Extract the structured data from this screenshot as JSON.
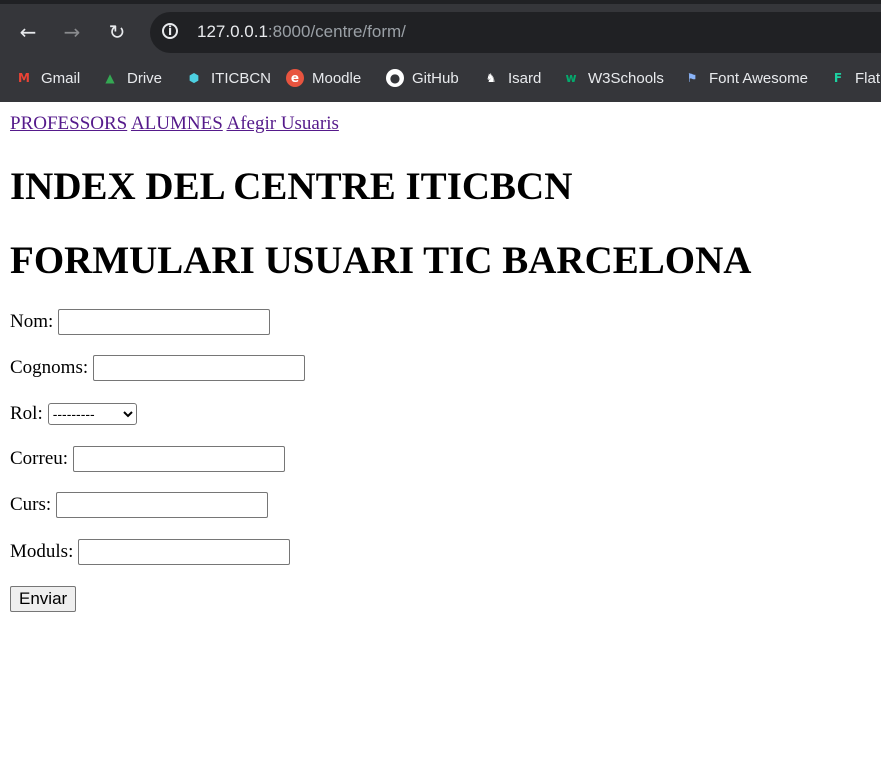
{
  "browser": {
    "back_icon": "arrow-left-icon",
    "forward_icon": "arrow-right-icon",
    "reload_icon": "reload-icon",
    "url_host": "127.0.0.1",
    "url_rest": ":8000/centre/form/",
    "bookmarks": [
      {
        "label": "Gmail",
        "icon": "gmail-icon",
        "color": "#ea4335"
      },
      {
        "label": "Drive",
        "icon": "drive-icon",
        "color": "#34a853"
      },
      {
        "label": "ITICBCN",
        "icon": "iticbcn-icon",
        "color": "#4dd0e1"
      },
      {
        "label": "Moodle",
        "icon": "moodle-icon",
        "color": "#e8543f"
      },
      {
        "label": "GitHub",
        "icon": "github-icon",
        "color": "#ffffff"
      },
      {
        "label": "Isard",
        "icon": "isard-icon",
        "color": "#ffffff"
      },
      {
        "label": "W3Schools",
        "icon": "w3schools-icon",
        "color": "#04aa6d"
      },
      {
        "label": "Font Awesome",
        "icon": "flag-icon",
        "color": "#8ab4f8"
      },
      {
        "label": "Flat",
        "icon": "flaticon-icon",
        "color": "#1dd1a1"
      }
    ]
  },
  "nav": {
    "professors": "PROFESSORS",
    "alumnes": "ALUMNES",
    "afegir": "Afegir Usuaris"
  },
  "headings": {
    "index": "INDEX DEL CENTRE ITICBCN",
    "form": "FORMULARI USUARI TIC BARCELONA"
  },
  "form": {
    "nom_label": "Nom:",
    "cognoms_label": "Cognoms:",
    "rol_label": "Rol:",
    "rol_selected": "---------",
    "correu_label": "Correu:",
    "curs_label": "Curs:",
    "moduls_label": "Moduls:",
    "submit_label": "Enviar"
  }
}
